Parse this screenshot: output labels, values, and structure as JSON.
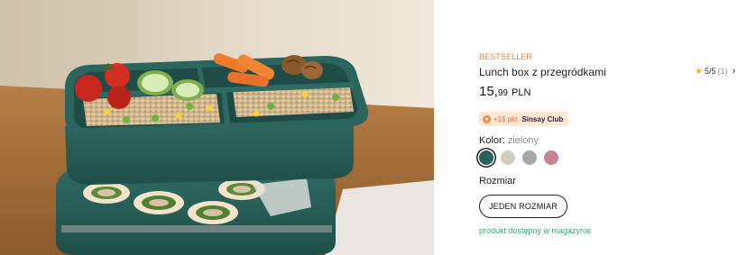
{
  "product": {
    "badge": "BESTSELLER",
    "title": "Lunch box z przegródkami",
    "rating": {
      "star_icon": "star-icon",
      "score": "5/5",
      "count": "(1)",
      "chevron": "›"
    },
    "price": {
      "main": "15,",
      "cents": "99",
      "currency": "PLN"
    },
    "club": {
      "icon": "sinsay-club-icon",
      "points": "+16 pkt",
      "name": "Sinsay Club"
    },
    "colour": {
      "label": "Kolor:",
      "value": "zielony",
      "swatches": [
        "#2b5f59",
        "#d2cbc1",
        "#a4a8a7",
        "#c88390"
      ],
      "selected_index": 0
    },
    "size": {
      "label": "Rozmiar",
      "button": "JEDEN ROZMIAR"
    },
    "stock": "produkt dostępny w magazynie"
  },
  "colors": {
    "badge": "#e2863c",
    "stock": "#37a46b",
    "star": "#f2b31c",
    "club_bg": "#fde6d6"
  }
}
